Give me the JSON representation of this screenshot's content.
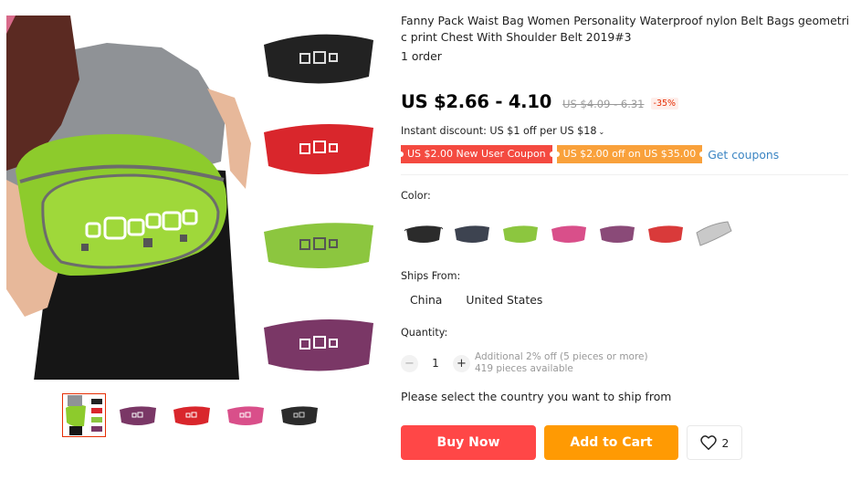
{
  "product": {
    "title": "Fanny Pack Waist Bag Women Personality Waterproof nylon Belt Bags geometric print Chest With Shoulder Belt 2019#3",
    "orders": "1 order",
    "price": "US $2.66 - 4.10",
    "original_price": "US $4.09 - 6.31",
    "discount": "-35%",
    "instant_discount": "Instant discount: US $1 off per US $18",
    "instant_caret": "⌄"
  },
  "coupons": {
    "new_user": "US $2.00 New User Coupon",
    "store": "US $2.00 off on US $35.00",
    "get_link": "Get coupons"
  },
  "color": {
    "label": "Color:",
    "swatches": [
      {
        "name": "black",
        "color": "#2b2b2b"
      },
      {
        "name": "dark-gray",
        "color": "#3d4350"
      },
      {
        "name": "green",
        "color": "#8cc63f"
      },
      {
        "name": "pink",
        "color": "#d94f8a"
      },
      {
        "name": "purple",
        "color": "#8a4a78"
      },
      {
        "name": "red",
        "color": "#d93a3a"
      },
      {
        "name": "silver",
        "color": "#c9c9c9"
      }
    ]
  },
  "shipping": {
    "label": "Ships From:",
    "options": [
      "China",
      "United States"
    ],
    "message": "Please select the country you want to ship from"
  },
  "quantity": {
    "label": "Quantity:",
    "value": "1",
    "minus": "−",
    "plus": "+",
    "additional": "Additional 2% off (5 pieces or more)",
    "available": "419 pieces available"
  },
  "actions": {
    "buy_now": "Buy Now",
    "add_to_cart": "Add to Cart",
    "wishlist_count": "2"
  },
  "gallery": {
    "thumbnails": [
      "main-photo",
      "purple-bag",
      "red-bag",
      "pink-bag",
      "black-bag"
    ]
  },
  "colors": {
    "buy": "#ff4747",
    "cart": "#ff9a03",
    "coupon_red": "#f44a40",
    "coupon_orange": "#f9a13b",
    "link": "#3b85c3"
  }
}
